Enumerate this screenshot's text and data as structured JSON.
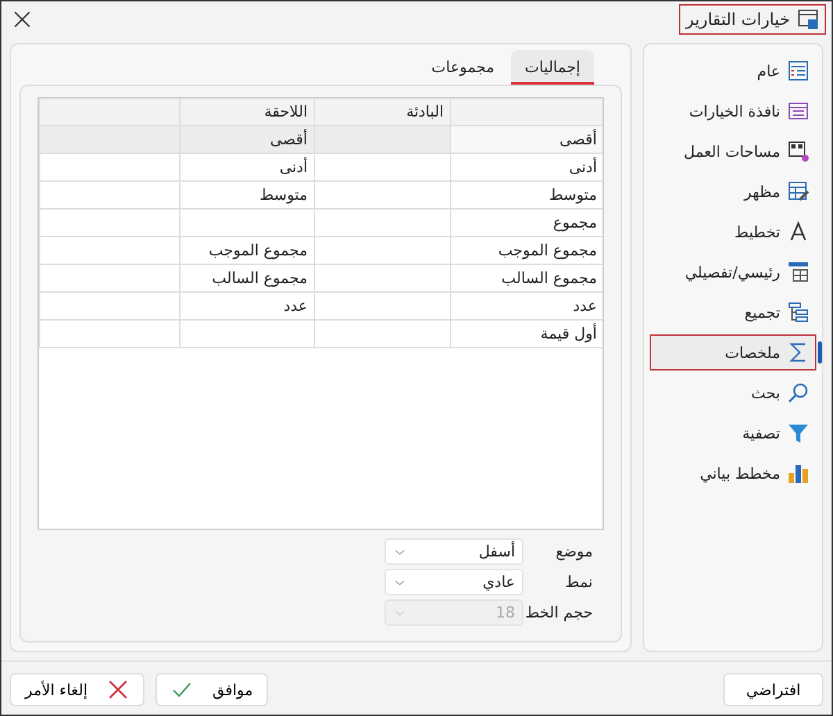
{
  "window": {
    "title": "خيارات التقارير"
  },
  "sidebar": {
    "items": [
      {
        "label": "عام",
        "kind": "general",
        "selected": false
      },
      {
        "label": "نافذة الخيارات",
        "kind": "window",
        "selected": false
      },
      {
        "label": "مساحات العمل",
        "kind": "workspace",
        "selected": false
      },
      {
        "label": "مظهر",
        "kind": "appearance",
        "selected": false
      },
      {
        "label": "تخطيط",
        "kind": "font",
        "selected": false
      },
      {
        "label": "رئيسي/تفصيلي",
        "kind": "master",
        "selected": false
      },
      {
        "label": "تجميع",
        "kind": "grouping",
        "selected": false
      },
      {
        "label": "ملخصات",
        "kind": "sum",
        "selected": true
      },
      {
        "label": "بحث",
        "kind": "search",
        "selected": false
      },
      {
        "label": "تصفية",
        "kind": "filter",
        "selected": false
      },
      {
        "label": "مخطط بياني",
        "kind": "chart",
        "selected": false
      }
    ]
  },
  "tabs": [
    {
      "label": "إجماليات",
      "selected": true
    },
    {
      "label": "مجموعات",
      "selected": false
    }
  ],
  "table": {
    "header": {
      "prefix": "البادئة",
      "suffix": "اللاحقة"
    },
    "rows": [
      {
        "name": "أقصى",
        "suffix": "أقصى",
        "selected": true
      },
      {
        "name": "أدنى",
        "suffix": "أدنى",
        "selected": false
      },
      {
        "name": "متوسط",
        "suffix": "متوسط",
        "selected": false
      },
      {
        "name": "مجموع",
        "selected": false
      },
      {
        "name": "مجموع الموجب",
        "suffix": "مجموع الموجب",
        "selected": false
      },
      {
        "name": "مجموع السالب",
        "suffix": "مجموع السالب",
        "selected": false
      },
      {
        "name": "عدد",
        "suffix": "عدد",
        "selected": false
      },
      {
        "name": "أول قيمة",
        "selected": false
      }
    ]
  },
  "fields": [
    {
      "label": "موضع",
      "value": "أسفل",
      "disabled": false
    },
    {
      "label": "نمط",
      "value": "عادي",
      "disabled": false
    },
    {
      "label": "حجم الخط",
      "value": "18",
      "disabled": true
    }
  ],
  "buttons": [
    {
      "label": "افتراضي",
      "kind": "default"
    },
    {
      "label": "موافق",
      "kind": "ok"
    },
    {
      "label": "إلغاء الأمر",
      "kind": "cancel"
    }
  ]
}
